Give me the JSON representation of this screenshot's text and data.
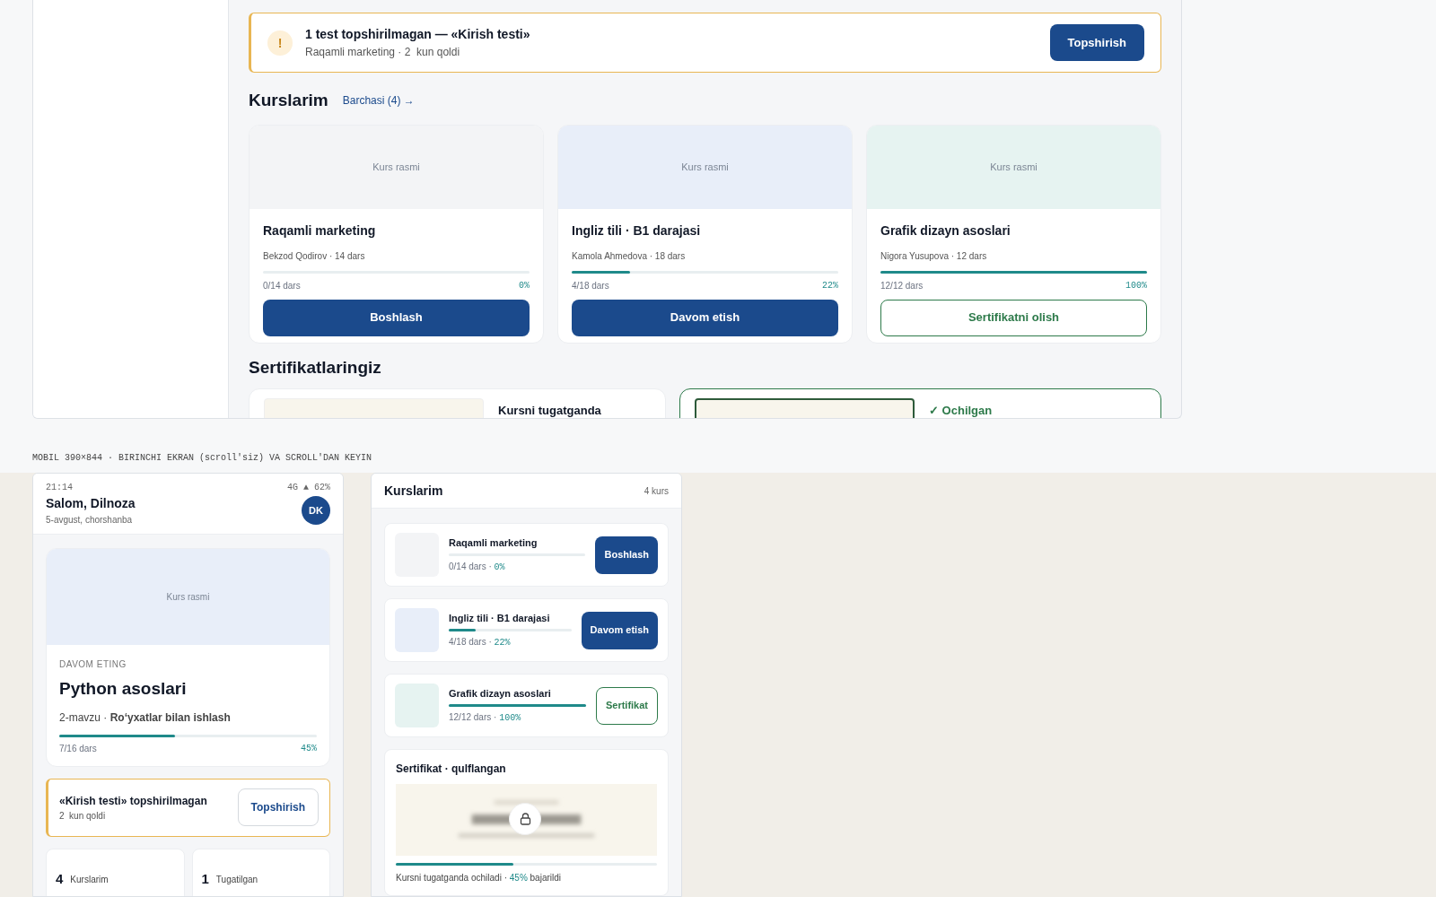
{
  "alert": {
    "icon": "!",
    "title": "1 test topshirilmagan — «Kirish testi»",
    "subtitle": "Raqamli marketing · 2  kun qoldi",
    "button": "Topshirish"
  },
  "courses_section": {
    "title": "Kurslarim",
    "link": "Barchasi (4) →"
  },
  "courses": [
    {
      "image_label": "Kurs rasmi",
      "color": "#f3f4f6",
      "title": "Raqamli marketing",
      "meta": "Bekzod Qodirov · 14 dars",
      "progress_text": "0/14 dars",
      "percent": "0%",
      "level": 0,
      "button": "Boshlash",
      "kind": "primary"
    },
    {
      "image_label": "Kurs rasmi",
      "color": "#e8eef9",
      "title": "Ingliz tili · B1 darajasi",
      "meta": "Kamola Ahmedova · 18 dars",
      "progress_text": "4/18 dars",
      "percent": "22%",
      "level": 0.22,
      "button": "Davom etish",
      "kind": "primary"
    },
    {
      "image_label": "Kurs rasmi",
      "color": "#e6f3f1",
      "title": "Grafik dizayn asoslari",
      "meta": "Nigora Yusupova · 12 dars",
      "progress_text": "12/12 dars",
      "percent": "100%",
      "level": 1,
      "button": "Sertifikatni olish",
      "kind": "outline"
    }
  ],
  "certificates": {
    "title": "Sertifikatlaringiz",
    "items": [
      {
        "kind": "locked",
        "label": "Kursni tugatganda"
      },
      {
        "kind": "unlocked",
        "label": "✓ Ochilgan"
      }
    ]
  },
  "mobile_caption": "MOBIL 390×844 · BIRINCHI EKRAN (scroll'siz) VA SCROLL'DAN KEYIN",
  "phone_home": {
    "time": "21:14",
    "indicators": "4G ▲ 62%",
    "greeting": "Salom, Dilnoza",
    "date": "5-avgust, chorshanba",
    "avatar": "DK",
    "continue": {
      "image_label": "Kurs rasmi",
      "eyebrow": "DAVOM ETING",
      "title": "Python asoslari",
      "topic": "2-mavzu · **Ro‘yxatlar bilan ishlash**",
      "progress_text": "7/16 dars",
      "percent": "45%",
      "level": 0.45
    },
    "alert": {
      "title": "«Kirish testi» topshirilmagan",
      "subtitle": "2  kun qoldi",
      "button": "Topshirish"
    },
    "stats": [
      {
        "value": "4",
        "label": "Kurslarim"
      },
      {
        "value": "1",
        "label": "Tugatilgan"
      }
    ]
  },
  "phone_courses": {
    "title": "Kurslarim",
    "count": "4 kurs",
    "courses": [
      {
        "color": "#f3f4f6",
        "title": "Raqamli marketing",
        "progress_text": "0/14 dars ·",
        "percent": "0%",
        "level": 0,
        "button": "Boshlash",
        "kind": "primary"
      },
      {
        "color": "#e8eef9",
        "title": "Ingliz tili · B1 darajasi",
        "progress_text": "4/18 dars ·",
        "percent": "22%",
        "level": 0.22,
        "button": "Davom etish",
        "kind": "primary"
      },
      {
        "color": "#e6f3f1",
        "title": "Grafik dizayn asoslari",
        "progress_text": "12/12 dars ·",
        "percent": "100%",
        "level": 1,
        "button": "Sertifikat",
        "kind": "outline"
      }
    ],
    "locked_certificate": {
      "title": "Sertifikat · qulflangan",
      "caption": "Kursni tugatganda ochiladi ·",
      "percent": "45%",
      "caption_end": "bajarildi",
      "level": 0.45
    }
  }
}
